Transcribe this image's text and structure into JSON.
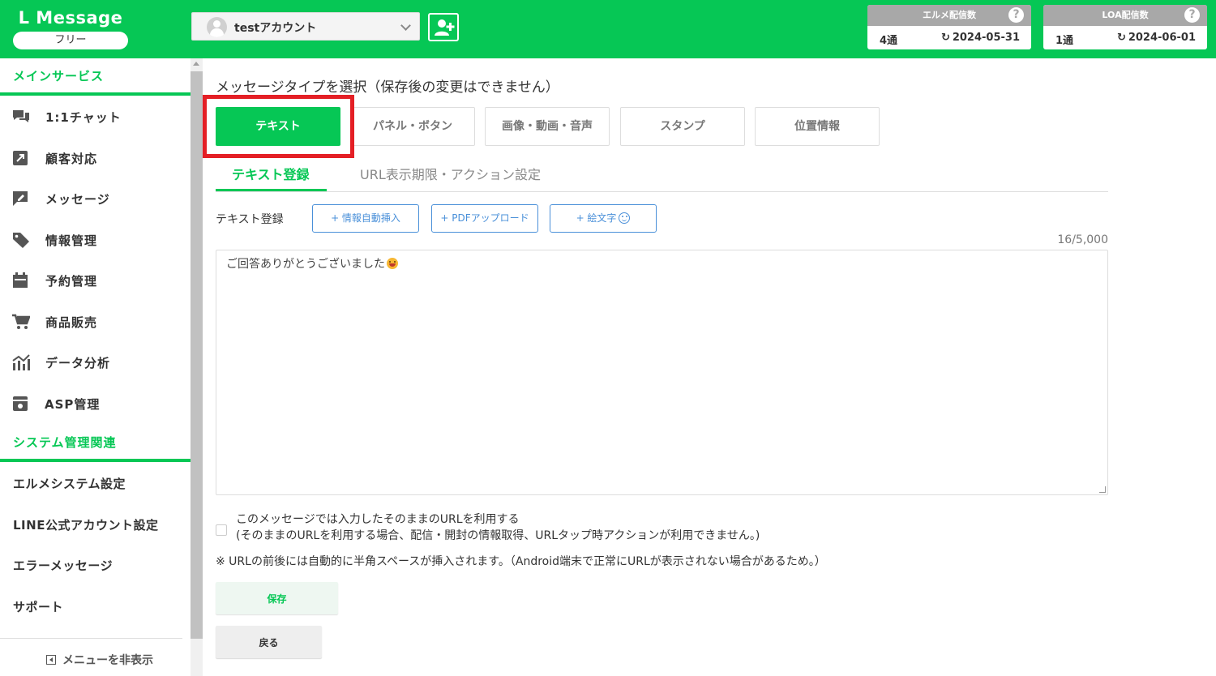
{
  "header": {
    "logo": "L Message",
    "plan": "フリー",
    "account_name": "testアカウント",
    "lmessage_quota": {
      "title": "エルメ配信数",
      "count": "4通",
      "reset_date": "2024-05-31"
    },
    "loa_quota": {
      "title": "LOA配信数",
      "count": "1通",
      "reset_date": "2024-06-01"
    },
    "help_glyph": "?"
  },
  "sidebar": {
    "main_section": "メインサービス",
    "items": [
      {
        "label": "1:1チャット",
        "icon": "chat-icon"
      },
      {
        "label": "顧客対応",
        "icon": "arrow-box-icon"
      },
      {
        "label": "メッセージ",
        "icon": "message-edit-icon"
      },
      {
        "label": "情報管理",
        "icon": "tag-icon"
      },
      {
        "label": "予約管理",
        "icon": "calendar-icon"
      },
      {
        "label": "商品販売",
        "icon": "cart-icon"
      },
      {
        "label": "データ分析",
        "icon": "chart-icon"
      },
      {
        "label": "ASP管理",
        "icon": "asp-icon"
      }
    ],
    "system_section": "システム管理関連",
    "system_items": [
      "エルメシステム設定",
      "LINE公式アカウント設定",
      "エラーメッセージ",
      "サポート"
    ],
    "hide_menu": "メニューを非表示"
  },
  "main": {
    "title": "メッセージタイプを選択（保存後の変更はできません）",
    "type_tabs": [
      "テキスト",
      "パネル・ボタン",
      "画像・動画・音声",
      "スタンプ",
      "位置情報"
    ],
    "sub_tabs": [
      "テキスト登録",
      "URL表示期限・アクション設定"
    ],
    "field_label": "テキスト登録",
    "tool_buttons": [
      "+ 情報自動挿入",
      "+ PDFアップロード",
      "+ 絵文字"
    ],
    "char_count": "16/5,000",
    "message_text": "ご回答ありがとうございました",
    "checkbox_line1": "このメッセージでは入力したそのままのURLを利用する",
    "checkbox_line2": "(そのままのURLを利用する場合、配信・開封の情報取得、URLタップ時アクションが利用できません。)",
    "note": "※ URLの前後には自動的に半角スペースが挿入されます。（Android端末で正常にURLが表示されない場合があるため。）",
    "save_label": "保存",
    "back_label": "戻る"
  },
  "colors": {
    "brand": "#06c755",
    "highlight": "#e41f25",
    "link": "#4a90d9"
  }
}
